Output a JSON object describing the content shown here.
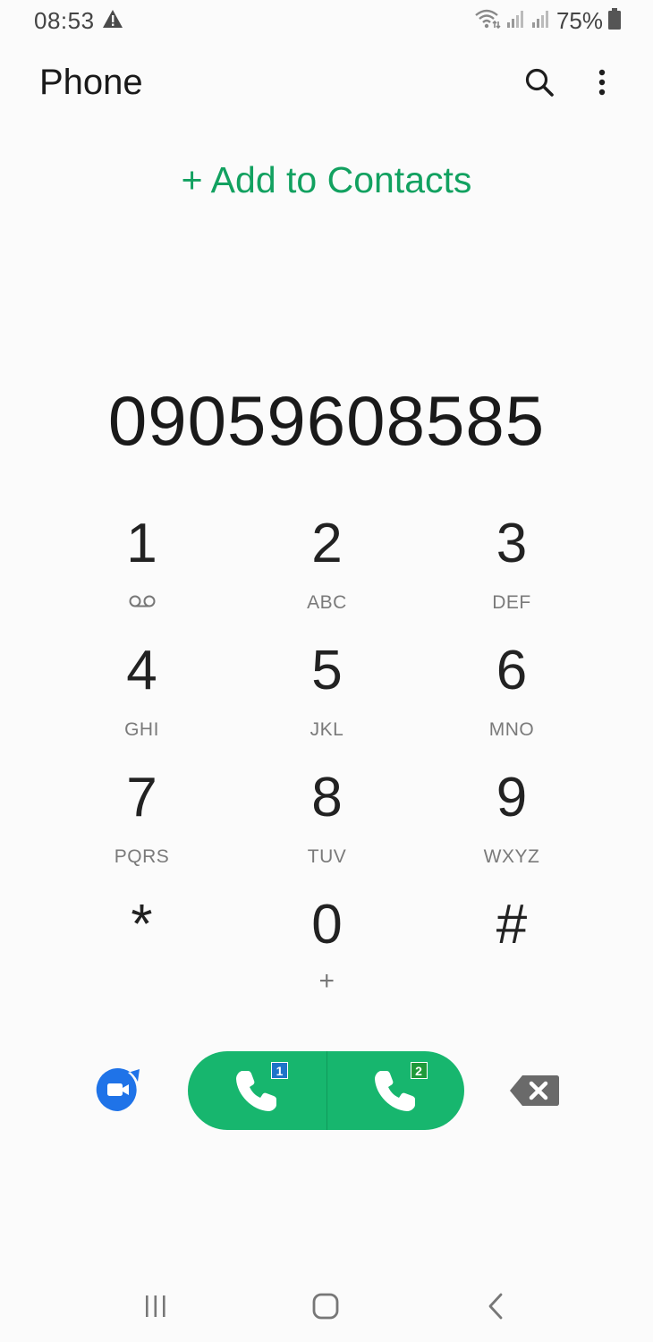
{
  "status_bar": {
    "time": "08:53",
    "battery": "75%",
    "icons": [
      "alert-icon",
      "wifi-icon",
      "signal-icon",
      "signal-icon",
      "battery-icon"
    ]
  },
  "header": {
    "title": "Phone",
    "icons": [
      "search-icon",
      "more-options-icon"
    ]
  },
  "add_contacts": "+ Add to Contacts",
  "dialed_number": "09059608585",
  "keypad": [
    {
      "digit": "1",
      "sub": "",
      "icon": "voicemail-icon"
    },
    {
      "digit": "2",
      "sub": "ABC"
    },
    {
      "digit": "3",
      "sub": "DEF"
    },
    {
      "digit": "4",
      "sub": "GHI"
    },
    {
      "digit": "5",
      "sub": "JKL"
    },
    {
      "digit": "6",
      "sub": "MNO"
    },
    {
      "digit": "7",
      "sub": "PQRS"
    },
    {
      "digit": "8",
      "sub": "TUV"
    },
    {
      "digit": "9",
      "sub": "WXYZ"
    },
    {
      "digit": "*",
      "sub": ""
    },
    {
      "digit": "0",
      "sub": "+"
    },
    {
      "digit": "#",
      "sub": ""
    }
  ],
  "call": {
    "sim1_label": "1",
    "sim2_label": "2",
    "accent": "#17b66e"
  },
  "colors": {
    "accent": "#12a160",
    "video": "#1f73e8"
  },
  "nav": [
    "recent-apps-icon",
    "home-icon",
    "back-icon"
  ]
}
